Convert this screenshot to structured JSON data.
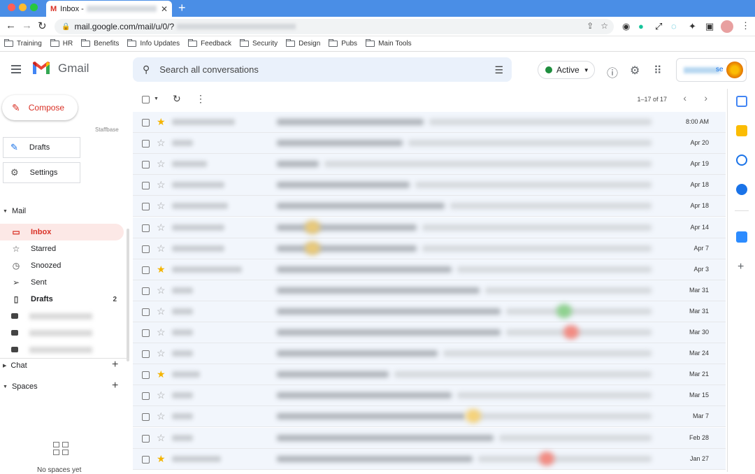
{
  "browser": {
    "tab_title": "Inbox - ",
    "new_tab": "+",
    "url": "mail.google.com/mail/u/0/?",
    "bookmarks": [
      "Training",
      "HR",
      "Benefits",
      "Info Updates",
      "Feedback",
      "Security",
      "Design",
      "Pubs",
      "Main Tools"
    ]
  },
  "header": {
    "app_name": "Gmail",
    "search_placeholder": "Search all conversations",
    "status": "Active",
    "account_suffix": "se"
  },
  "sidebar": {
    "compose": "Compose",
    "staffbase": "Staffbase",
    "drafts_button": "Drafts",
    "settings_button": "Settings",
    "mail_section": "Mail",
    "items": [
      {
        "label": "Inbox",
        "icon": "inbox-icon",
        "selected": true
      },
      {
        "label": "Starred",
        "icon": "star-icon"
      },
      {
        "label": "Snoozed",
        "icon": "clock-icon"
      },
      {
        "label": "Sent",
        "icon": "send-icon"
      },
      {
        "label": "Drafts",
        "icon": "draft-icon",
        "count": "2"
      }
    ],
    "chat_section": "Chat",
    "spaces_section": "Spaces",
    "no_spaces": "No spaces yet"
  },
  "list": {
    "pager": "1–17 of 17",
    "rows": [
      {
        "date": "8:00 AM",
        "starred": true
      },
      {
        "date": "Apr 20",
        "starred": false
      },
      {
        "date": "Apr 19",
        "starred": false
      },
      {
        "date": "Apr 18",
        "starred": false
      },
      {
        "date": "Apr 18",
        "starred": false
      },
      {
        "date": "Apr 14",
        "starred": false
      },
      {
        "date": "Apr 7",
        "starred": false
      },
      {
        "date": "Apr 3",
        "starred": true
      },
      {
        "date": "Mar 31",
        "starred": false
      },
      {
        "date": "Mar 31",
        "starred": false
      },
      {
        "date": "Mar 30",
        "starred": false
      },
      {
        "date": "Mar 24",
        "starred": false
      },
      {
        "date": "Mar 21",
        "starred": true
      },
      {
        "date": "Mar 15",
        "starred": false
      },
      {
        "date": "Mar 7",
        "starred": false
      },
      {
        "date": "Feb 28",
        "starred": false
      },
      {
        "date": "Jan 27",
        "starred": true
      }
    ]
  },
  "colors": {
    "accent": "#d93025",
    "brand_blue": "#4a8ee6",
    "row_bg": "#f2f6fc",
    "star": "#f4b400",
    "active_green": "#1e8e3e"
  }
}
